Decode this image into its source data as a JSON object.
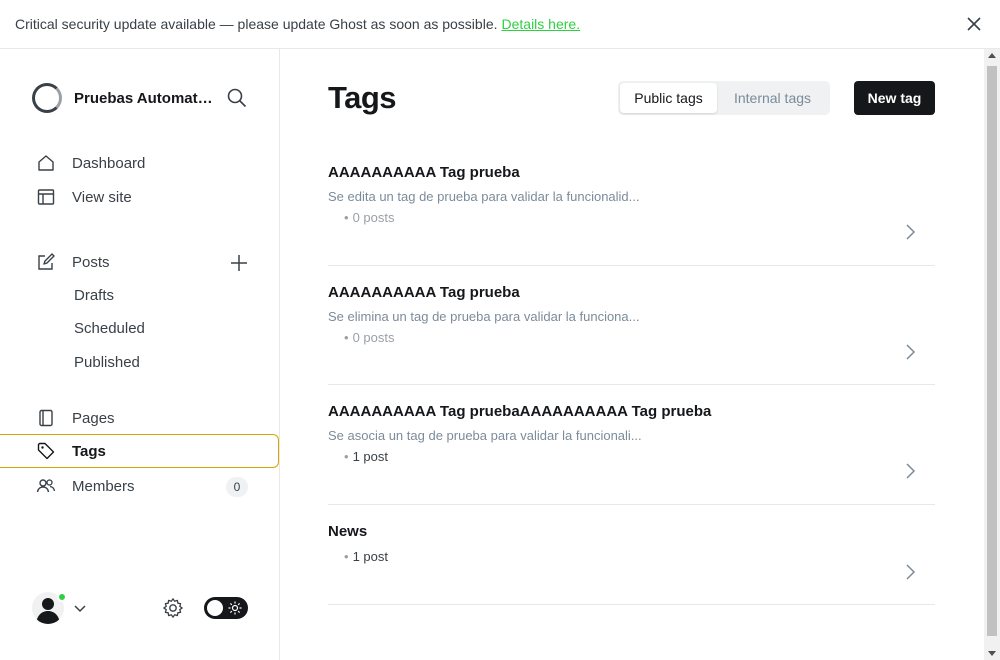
{
  "banner": {
    "message": "Critical security update available — please update Ghost as soon as possible.",
    "link_text": "Details here."
  },
  "sidebar": {
    "site_name": "Pruebas Automatizadas",
    "nav": {
      "dashboard": "Dashboard",
      "view_site": "View site",
      "posts": "Posts",
      "drafts": "Drafts",
      "scheduled": "Scheduled",
      "published": "Published",
      "pages": "Pages",
      "tags": "Tags",
      "members": "Members"
    },
    "members_count": "0"
  },
  "main": {
    "title": "Tags",
    "tabs": {
      "public": "Public tags",
      "internal": "Internal tags"
    },
    "new_tag_label": "New tag",
    "tags": [
      {
        "name": "AAAAAAAAAA Tag prueba",
        "description": "Se edita un tag de prueba para validar la funcionalid...",
        "count": "0 posts"
      },
      {
        "name": "AAAAAAAAAA Tag prueba",
        "description": "Se elimina un tag de prueba para validar la funciona...",
        "count": "0 posts"
      },
      {
        "name": "AAAAAAAAAA Tag pruebaAAAAAAAAAA Tag prueba",
        "description": "Se asocia un tag de prueba para validar la funcionali...",
        "count": "1 post"
      },
      {
        "name": "News",
        "description": "",
        "count": "1 post"
      }
    ]
  },
  "colors": {
    "accent": "#30cf43",
    "active_border": "#d8a600",
    "primary_button": "#15171a"
  }
}
